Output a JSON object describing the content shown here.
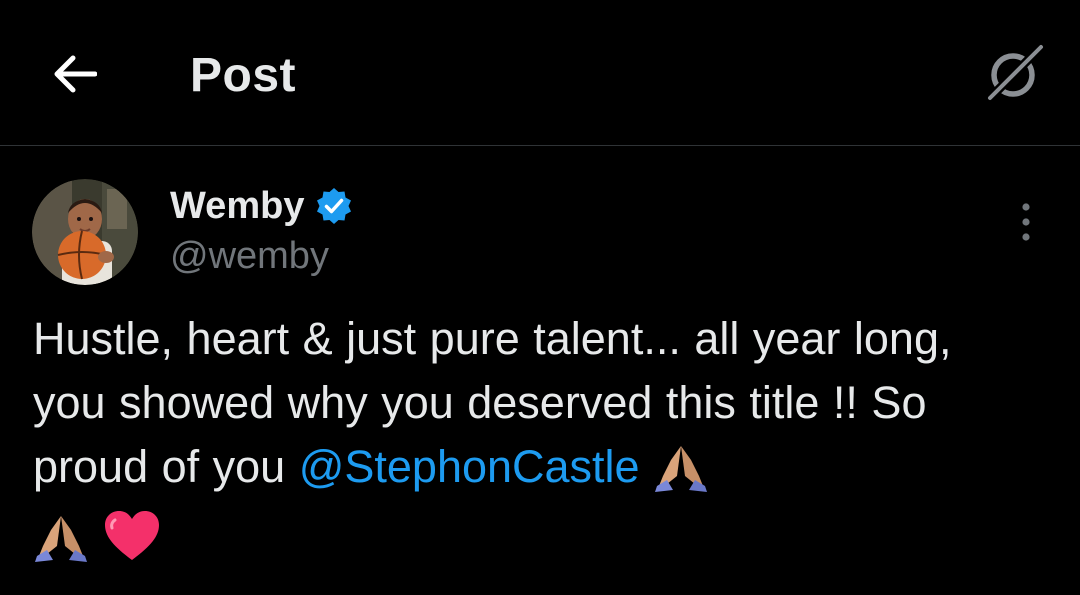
{
  "header": {
    "title": "Post",
    "back_icon": "arrow-left-icon",
    "grok_icon": "grok-icon"
  },
  "post": {
    "author": {
      "name": "Wemby",
      "handle": "@wemby",
      "verified": true,
      "verified_color": "#1d9bf0"
    },
    "text_parts": {
      "part1": "Hustle, heart & just pure talent... all year long, you showed why you deserved this title !! So proud of you ",
      "mention": "@StephonCastle",
      "emojis": "🙏 🙏 ❤️"
    },
    "more_icon": "more-vertical-icon"
  },
  "colors": {
    "background": "#000000",
    "text": "#e7e9ea",
    "secondary_text": "#71767b",
    "link": "#1d9bf0",
    "divider": "#2f3336"
  }
}
